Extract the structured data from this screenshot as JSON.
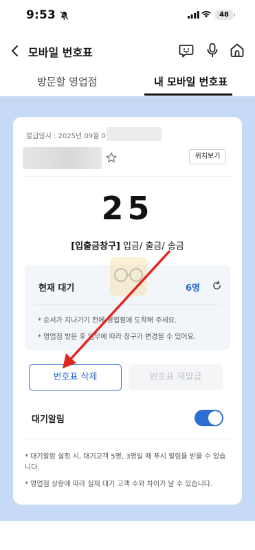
{
  "status_bar": {
    "time": "9:53",
    "battery": "48"
  },
  "header": {
    "title": "모바일 번호표"
  },
  "tabs": [
    {
      "label": "방문할 영업점"
    },
    {
      "label": "내 모바일 번호표"
    }
  ],
  "card": {
    "issue_date": "발급일시 : 2025년 09월 09",
    "location_button": "위치보기",
    "ticket_number": "25",
    "counter_bracket": "[입출금창구]",
    "counter_services": " 입금/ 출금/ 송금",
    "waiting": {
      "label": "현재 대기",
      "count": "6명",
      "notes": [
        "* 순서가 지나가기 전에 영업점에 도착해 주세요.",
        "* 영업점 방문 후 업무에 따라 창구가 변경될 수 있어요."
      ]
    },
    "delete_button": "번호표 삭제",
    "reissue_button": "번호표 재발급",
    "alarm": {
      "label": "대기알림",
      "enabled": true,
      "notes": [
        "* 대기알람 설정 시, 대기고객 5명, 3명일 때 푸시 알림을 받을 수 있습니다.",
        "* 영업점 상황에 따라 실제 대기 고객 수와 차이가 날 수 있습니다."
      ]
    }
  },
  "colors": {
    "accent": "#2d6fd1",
    "background": "#c6daf6",
    "annotation_arrow": "#e0261e"
  }
}
